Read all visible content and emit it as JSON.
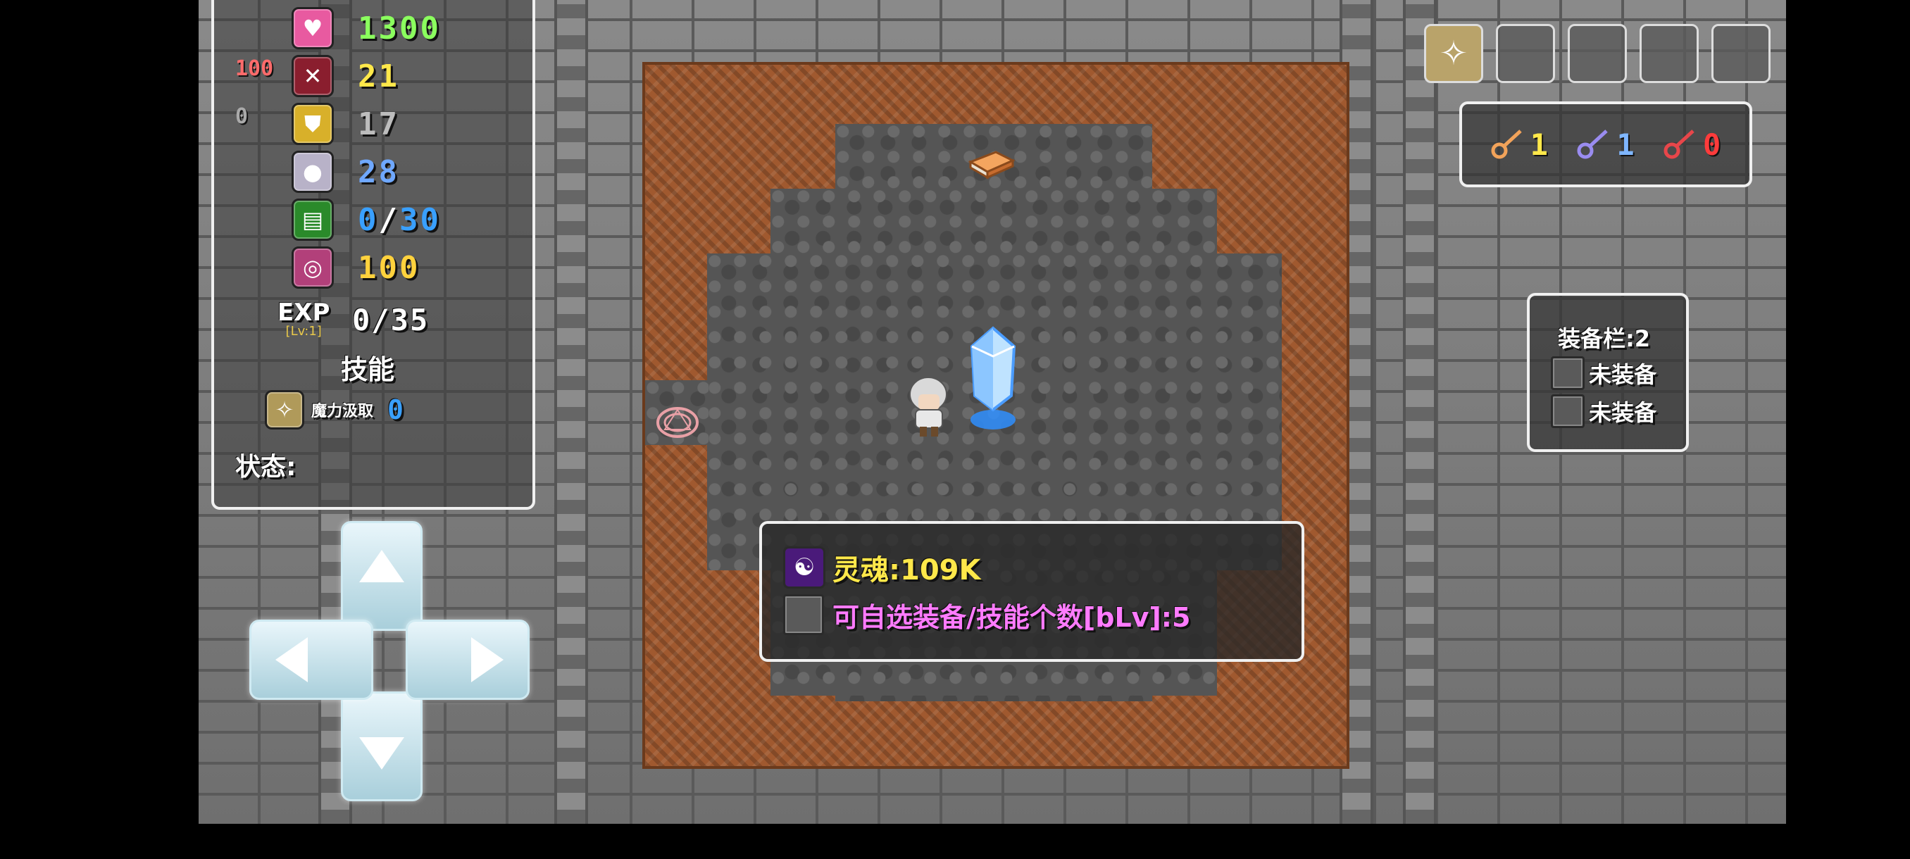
{
  "stats": {
    "hp": "1300",
    "attack": "21",
    "attack_side": "100",
    "defense": "17",
    "defense_side": "0",
    "magic_def": "28",
    "book_current": "0",
    "book_sep": "/",
    "book_max": "30",
    "mana": "100",
    "exp_label": "EXP",
    "level_label": "[Lv:1]",
    "exp_value": "0/35",
    "skills_heading": "技能",
    "skill_name": "魔力汲取",
    "skill_value": "0",
    "status_label": "状态:"
  },
  "keys": [
    {
      "count": "1",
      "color": "#f2a35a",
      "count_color": "#ffe84a"
    },
    {
      "count": "1",
      "color": "#9a8cf0",
      "count_color": "#7fb6ff"
    },
    {
      "count": "0",
      "color": "#e8464a",
      "count_color": "#ff3b3b"
    }
  ],
  "equipment": {
    "title": "装备栏:2",
    "slots": [
      "未装备",
      "未装备"
    ]
  },
  "info": {
    "soul_label": "灵魂:109K",
    "option_label": "可自选装备/技能个数[bLv]:5"
  },
  "colors": {
    "hp": "#8bff5e",
    "attack": "#ffe84a",
    "defense": "#bdbdbd",
    "magic_def": "#6fa8ff",
    "book": "#39a0ff",
    "mana": "#ffd23d",
    "info_text": "#ff7bff",
    "info_value": "#ffe84a"
  },
  "icons": {
    "hp": "heart-icon",
    "attack": "sword-icon",
    "defense": "shield-icon",
    "magic_def": "orb-icon",
    "book": "book-icon",
    "mana": "spiral-icon",
    "skill": "magic-eye-icon"
  }
}
